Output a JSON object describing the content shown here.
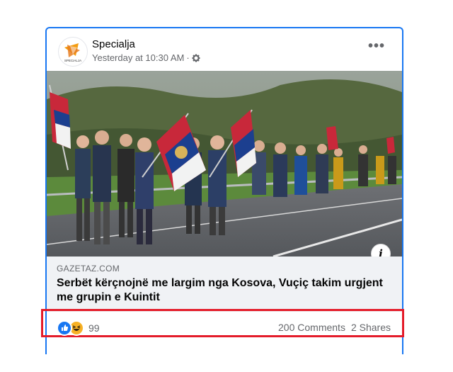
{
  "post": {
    "page_name": "Specialja",
    "timestamp": "Yesterday at 10:30 AM",
    "separator": "·",
    "audience_icon": "gear-icon",
    "menu_icon": "more-dots-icon",
    "avatar_text": "SPECIALJA"
  },
  "link": {
    "domain": "GAZETAZ.COM",
    "headline": "Serbët kërçnojnë me largim nga Kosova, Vuçiç takim urgjent me grupin e Kuintit",
    "info_icon": "i"
  },
  "engagement": {
    "reaction_icons": [
      "like-icon",
      "haha-icon"
    ],
    "reaction_count": "99",
    "comments": "200 Comments",
    "shares": "2 Shares"
  },
  "colors": {
    "accent": "#1877f2",
    "highlight": "#e41c2a",
    "muted": "#65676b",
    "link_bg": "#f0f2f5"
  }
}
